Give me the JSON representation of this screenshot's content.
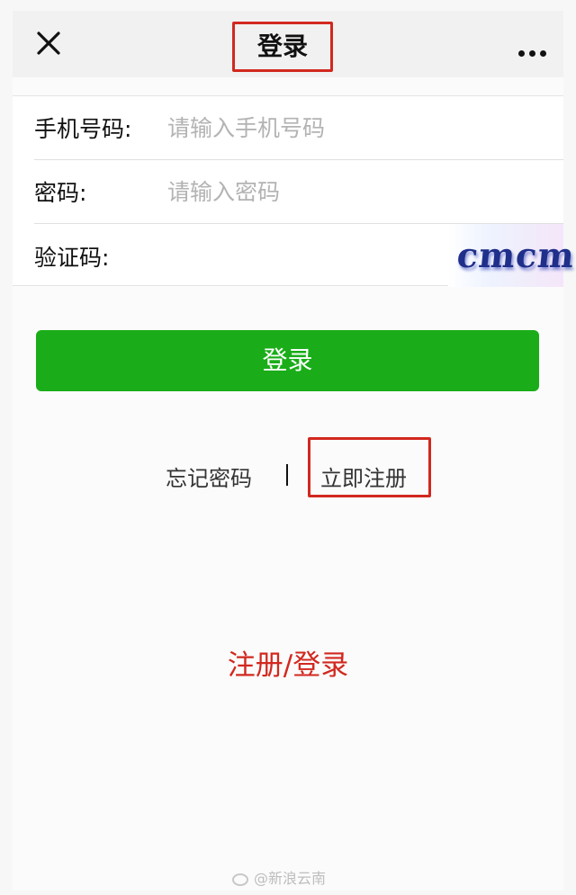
{
  "navbar": {
    "title": "登录",
    "close_icon": "close-icon",
    "more_icon": "more-horizontal-icon"
  },
  "form": {
    "phone": {
      "label": "手机号码:",
      "placeholder": "请输入手机号码",
      "value": ""
    },
    "password": {
      "label": "密码:",
      "placeholder": "请输入密码",
      "value": ""
    },
    "captcha": {
      "label": "验证码:",
      "value": "",
      "image_text": "cmcm"
    }
  },
  "login_button": "登录",
  "links": {
    "forgot": "忘记密码",
    "divider": "|",
    "register": "立即注册"
  },
  "caption": "注册/登录",
  "watermark": "@新浪云南",
  "colors": {
    "primary": "#1aad19",
    "highlight": "#d2281f"
  }
}
